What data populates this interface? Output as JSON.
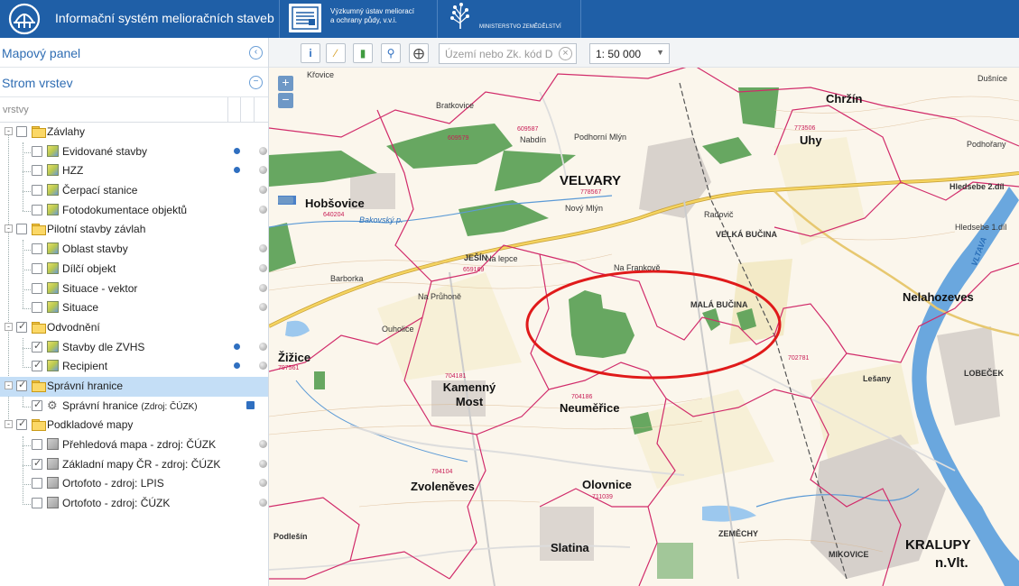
{
  "header": {
    "title": "Informační systém melioračních staveb",
    "vu_line1": "Výzkumný ústav meliorací",
    "vu_line2": "a ochrany půdy, v.v.i.",
    "ministry": "MINISTERSTVO ZEMĚDĚLSTVÍ",
    "brand_color": "#1f5fa7"
  },
  "panel": {
    "map_panel_title": "Mapový panel",
    "layer_tree_title": "Strom vrstev",
    "filter_label": "vrstvy"
  },
  "tree": {
    "g1": {
      "label": "Závlahy",
      "checked": false
    },
    "g1_items": [
      "Evidované stavby",
      "HZZ",
      "Čerpací stanice",
      "Fotodokumentace objektů"
    ],
    "g2": {
      "label": "Pilotní stavby závlah",
      "checked": false
    },
    "g2_items": [
      "Oblast stavby",
      "Dílčí objekt",
      "Situace - vektor",
      "Situace"
    ],
    "g3": {
      "label": "Odvodnění",
      "checked": true
    },
    "g3_items": [
      "Stavby dle ZVHS",
      "Recipient"
    ],
    "g4": {
      "label": "Správní hranice",
      "checked": true
    },
    "g4_item": "Správní hranice",
    "g4_item_source": "(Zdroj: ČÚZK)",
    "g5": {
      "label": "Podkladové mapy",
      "checked": true
    },
    "g5_items": [
      "Přehledová mapa - zdroj: ČÚZK",
      "Základní mapy ČR - zdroj: ČÚZK",
      "Ortofoto - zdroj: LPIS",
      "Ortofoto - zdroj: ČÚZK"
    ]
  },
  "toolbar": {
    "search_placeholder": "Území nebo Zk. kód D",
    "scale_value": "1: 50 000"
  },
  "map": {
    "zoom_in": "+",
    "zoom_out": "−",
    "labels": {
      "velvary": "VELVARY",
      "velvary_code": "778567",
      "hobsovice": "Hobšovice",
      "hobsovice_code": "640204",
      "bratkovice": "Bratkovice",
      "bratkovice_code": "609579",
      "nabdin": "Nabdín",
      "nabdin_code": "609587",
      "krovice": "Křovice",
      "chrzin": "Chržín",
      "dusnice": "Dušníce",
      "uhy": "Uhy",
      "uhy_code": "773506",
      "podhorany": "Podhořany",
      "hledsebe2": "Hledsebe 2.díl",
      "hledsebe1": "Hledsebe 1.díl",
      "velka_bucina": "VELKÁ BUČINA",
      "jesin": "JEŠÍN",
      "jesin_code": "659169",
      "nelahozeves": "Nelahozeves",
      "nelahozeves_code": "702781",
      "ouholice": "Ouholice",
      "zizice": "Žižice",
      "zizice_code": "797561",
      "kamenny_most": "Kamenný Most",
      "kamenny_most_code": "704181",
      "neumerice": "Neuměřice",
      "neumerice_code": "704186",
      "olovnice": "Olovnice",
      "olovnice_code": "711039",
      "zvoleneves": "Zvoleněves",
      "zvoleneves_code": "794104",
      "slatina": "Slatina",
      "kralupy": "KRALUPY",
      "kralupy2": "n.Vlt.",
      "mikovice": "MIKOVICE",
      "lobecek": "LOBEČEK",
      "lesany": "Lešany",
      "podlesin": "Podlešín",
      "mala_bucina": "MALÁ BUČINA",
      "na_frankove": "Na Frankově",
      "na_pruhone": "Na Průhoně",
      "na_lepce": "Na lepce",
      "novy_mlyn": "Nový Mlýn",
      "podhorni_mlyn": "Podhorní Mlýn",
      "radovic": "Radovič",
      "barborka": "Barborka",
      "vltava": "VLTAVA",
      "zemechy": "ZEMĚCHY",
      "bakovsky": "Bakovský p."
    }
  }
}
